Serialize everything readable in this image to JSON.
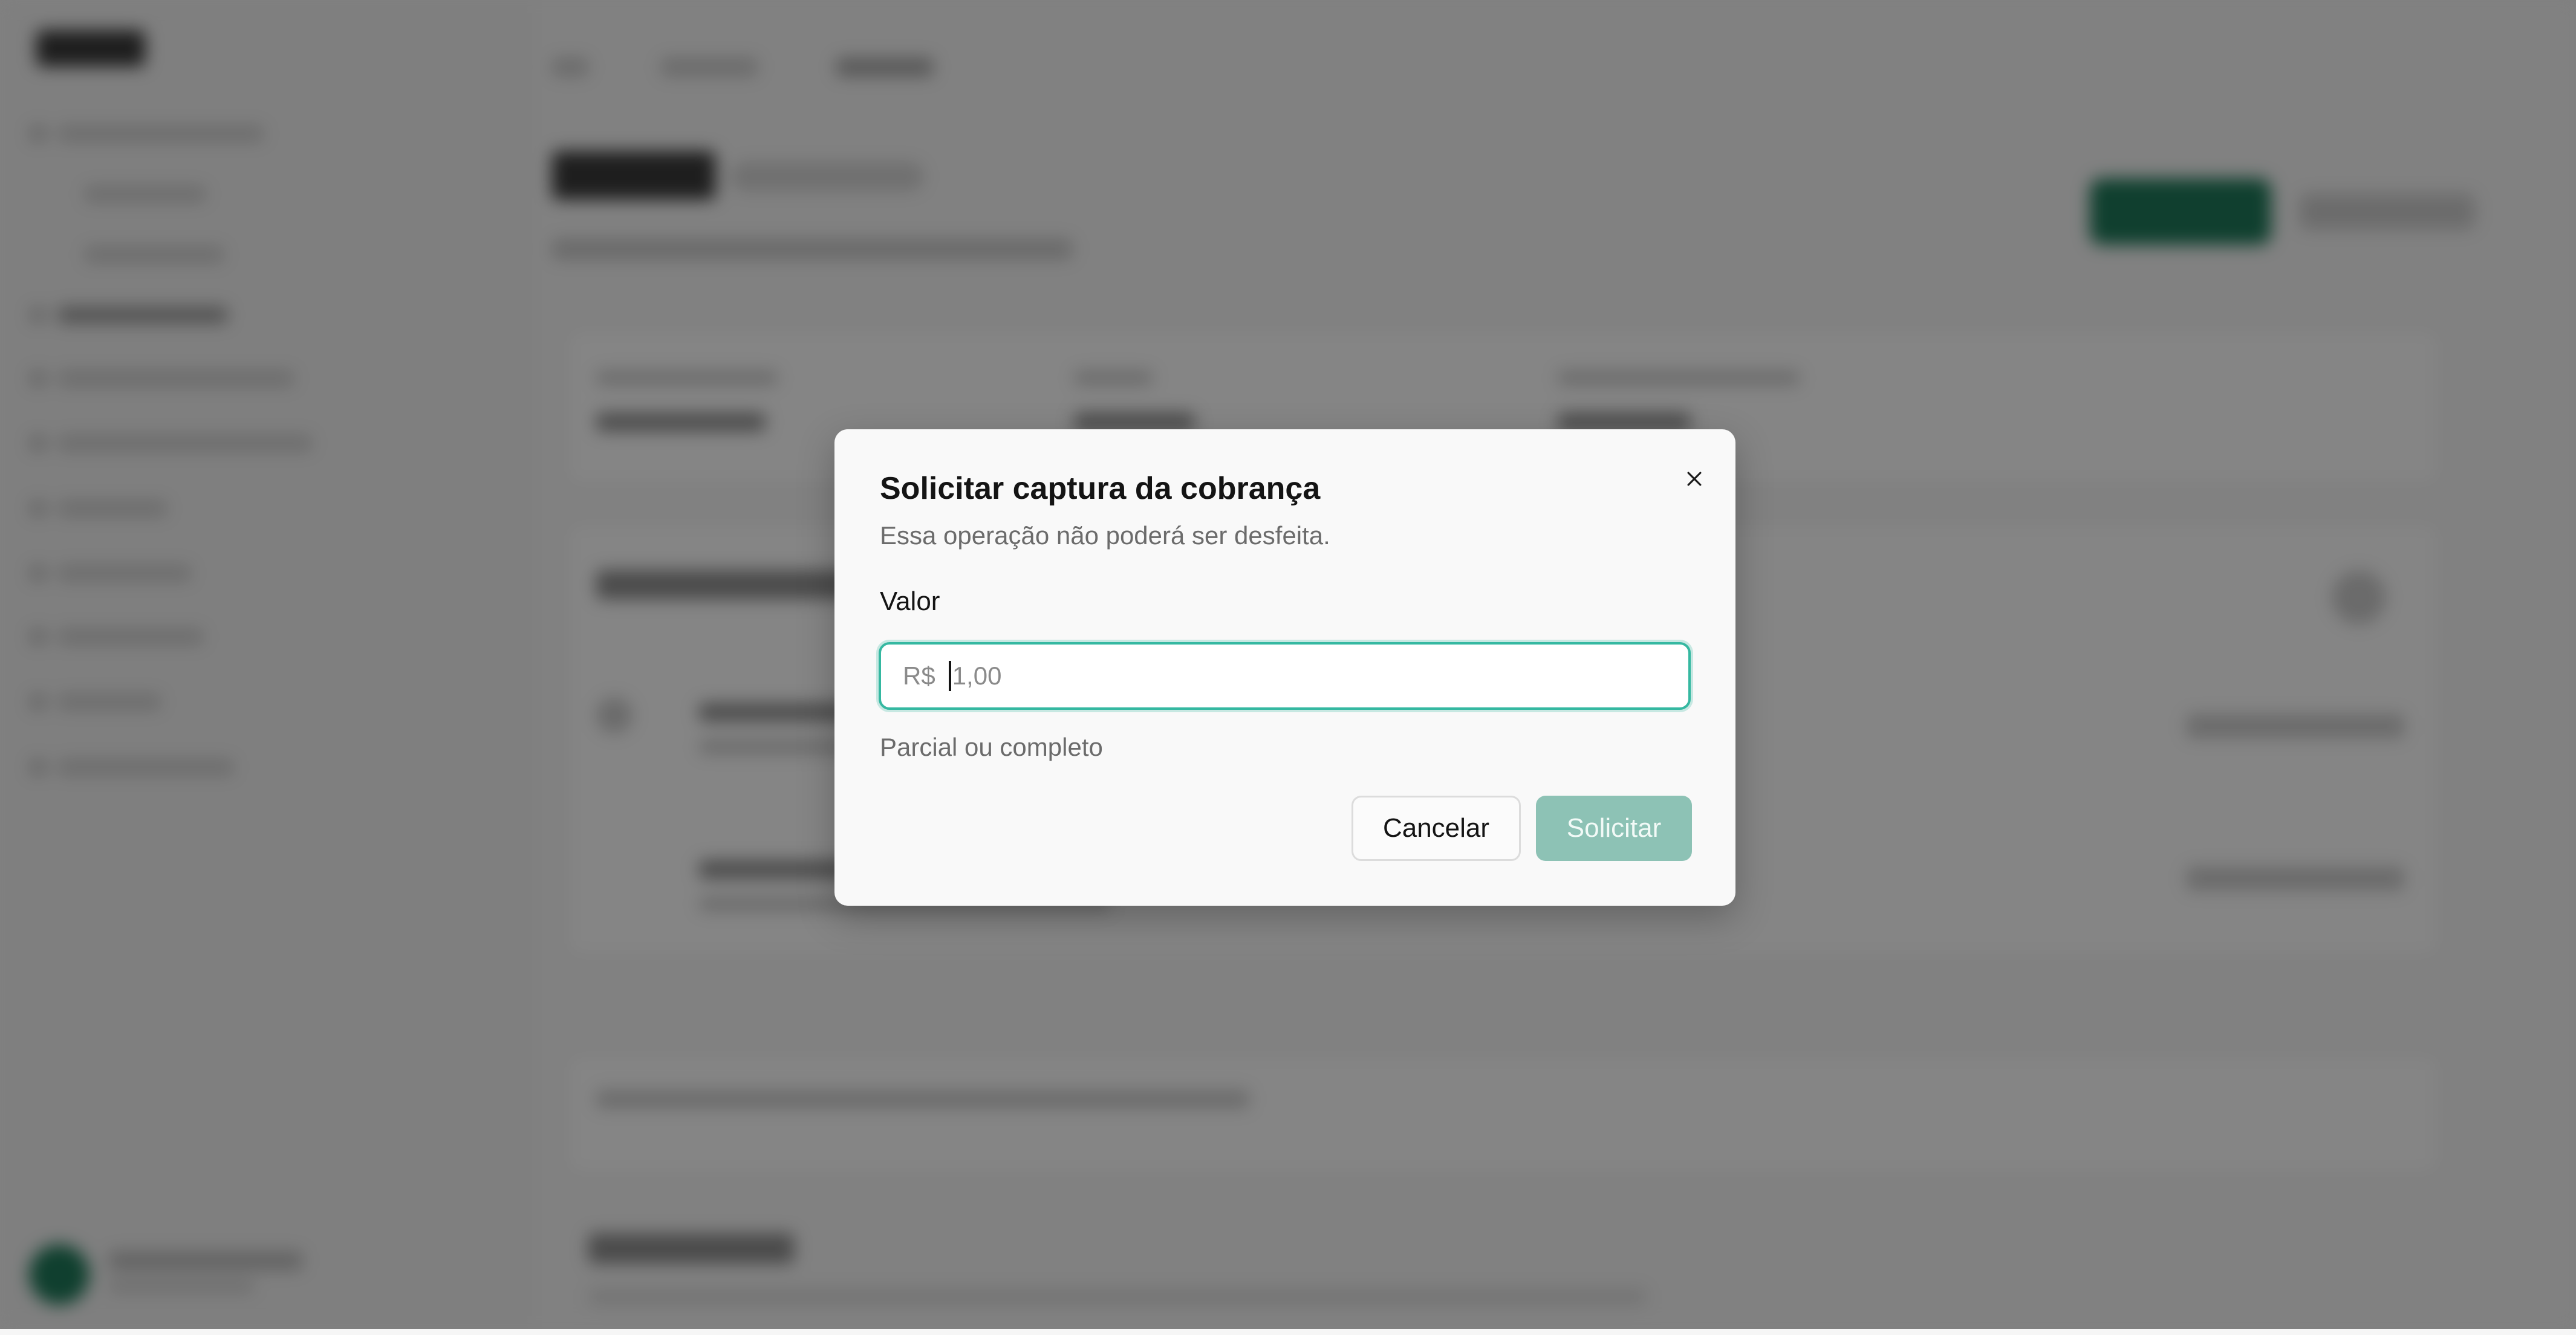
{
  "modal": {
    "title": "Solicitar captura da cobrança",
    "description": "Essa operação não poderá ser desfeita.",
    "field_label": "Valor",
    "input": {
      "prefix": "R$",
      "value": "",
      "placeholder": "1,00"
    },
    "helper_text": "Parcial ou completo",
    "cancel_label": "Cancelar",
    "submit_label": "Solicitar",
    "close_icon": "close-icon"
  },
  "colors": {
    "overlay": "rgba(0,0,0,0.48)",
    "accent_focus": "#35b8a1",
    "submit_disabled": "#8dc2b5",
    "brand_green": "#1f7a5a"
  }
}
